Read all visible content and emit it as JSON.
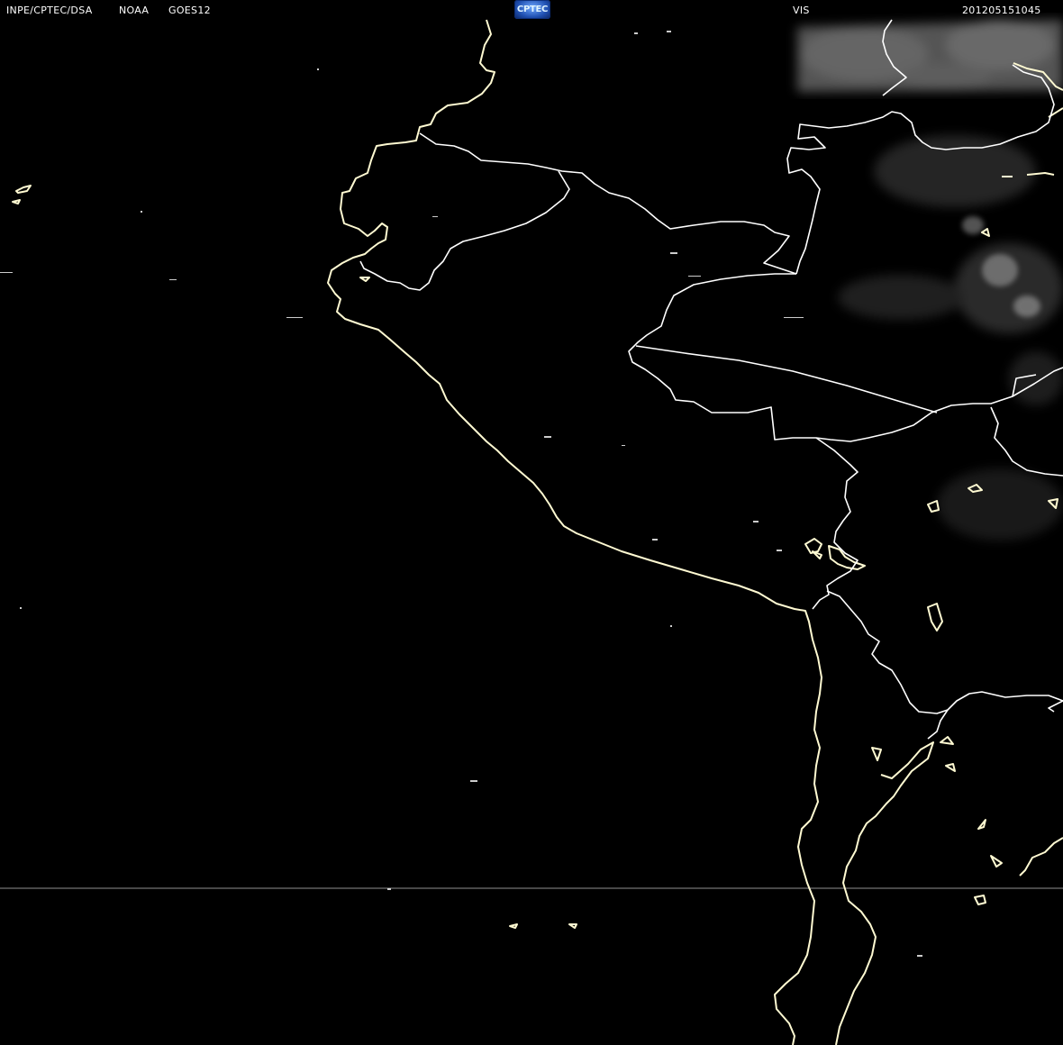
{
  "header": {
    "agency": "INPE/CPTEC/DSA",
    "noaa": "NOAA",
    "satellite": "GOES12",
    "logo_text": "CPTEC",
    "channel": "VIS",
    "timestamp": "201205151045"
  },
  "colors": {
    "background": "#000000",
    "coastline": "#fffad2",
    "border": "#ffffff",
    "clouds": "#8a8a8a",
    "scanline": "#9a9a9a",
    "header_text": "#ffffff"
  },
  "icons": {
    "logo": "cptec-logo-icon"
  }
}
